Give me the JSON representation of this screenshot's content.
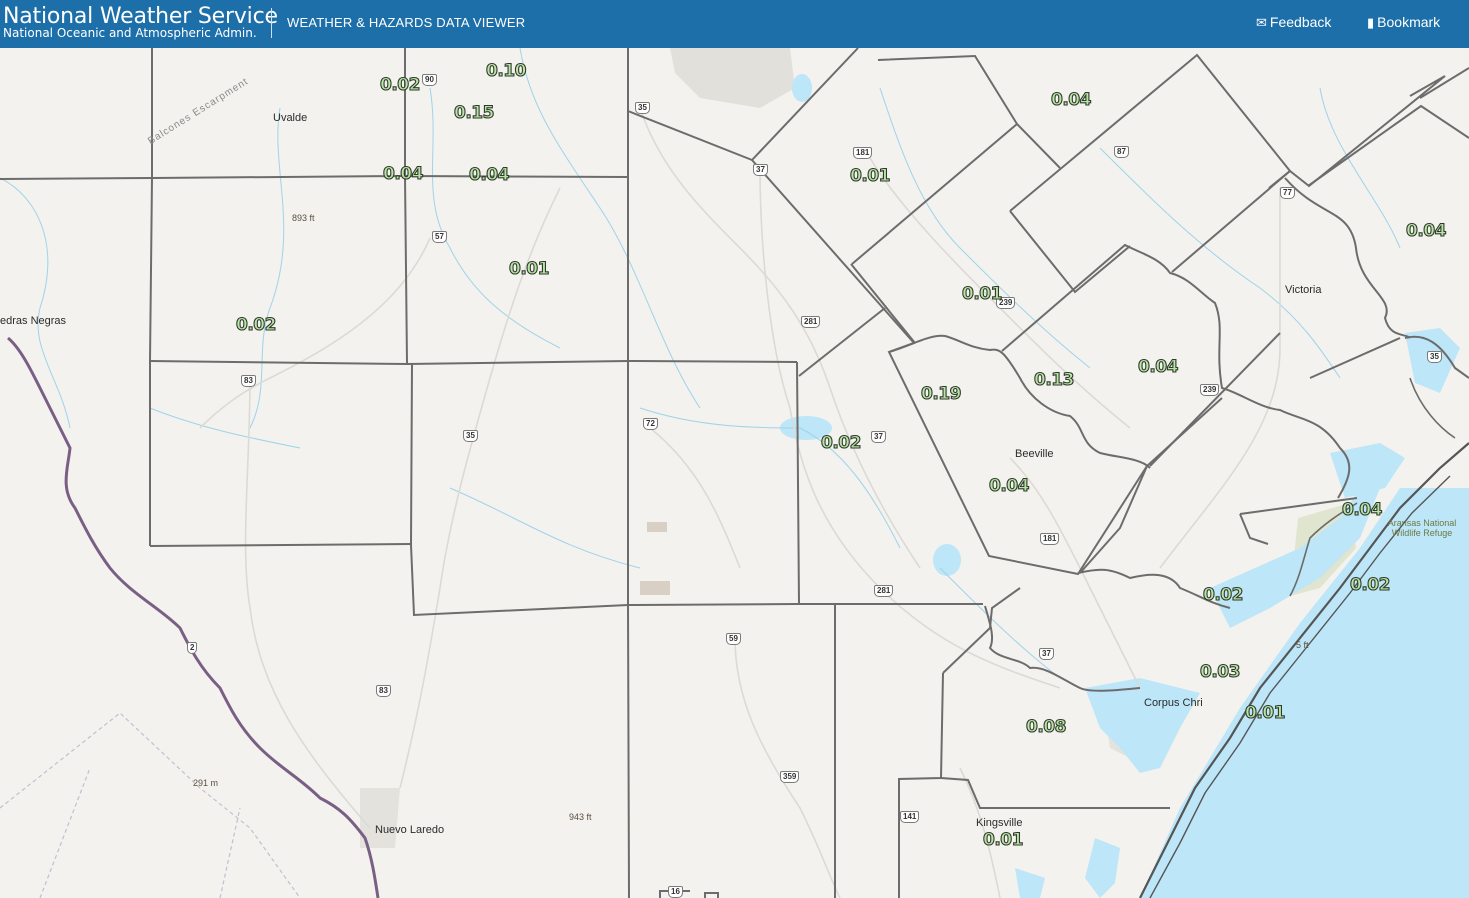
{
  "header": {
    "brand_title": "National Weather Service",
    "brand_subtitle": "National Oceanic and Atmospheric Admin.",
    "app_title": "WEATHER & HAZARDS DATA VIEWER",
    "feedback_label": "Feedback",
    "bookmark_label": "Bookmark",
    "feedback_icon": "envelope-icon",
    "bookmark_icon": "bookmark-icon",
    "bar_color": "#1d6fa9"
  },
  "map": {
    "colors": {
      "land": "#f3f2ee",
      "water": "#bde6f8",
      "county_border": "#6c6c6c",
      "international_border": "#7a5f85",
      "qpf_label_fill": "#b9e3a8"
    },
    "qpf_values": [
      "0.02",
      "0.10",
      "0.15",
      "0.04",
      "0.04",
      "0.01",
      "0.02",
      "0.04",
      "0.01",
      "0.01",
      "0.13",
      "0.04",
      "0.19",
      "0.02",
      "0.04",
      "0.04",
      "0.04",
      "0.02",
      "0.02",
      "0.03",
      "0.01",
      "0.08",
      "0.01"
    ],
    "places": [
      "Uvalde",
      "Piedras Negras",
      "Victoria",
      "Beeville",
      "Corpus Christi",
      "Kingsville",
      "Nuevo Laredo"
    ],
    "place_visible_text": [
      "Uvalde",
      "edras Negras",
      "Victoria",
      "Beeville",
      "Corpus Chri",
      "Kingsville",
      "Nuevo Laredo"
    ],
    "elevations": [
      "893 ft",
      "943 ft",
      "291 m",
      "5 ft"
    ],
    "route_shields": [
      "90",
      "35",
      "37",
      "181",
      "87",
      "77",
      "57",
      "281",
      "239",
      "35",
      "83",
      "35",
      "72",
      "37",
      "181",
      "239",
      "281",
      "2",
      "83",
      "59",
      "37",
      "359",
      "141",
      "16"
    ],
    "escarpment": "Balcones Escarpment",
    "refuge": "Aransas National Wildlife Refuge"
  }
}
